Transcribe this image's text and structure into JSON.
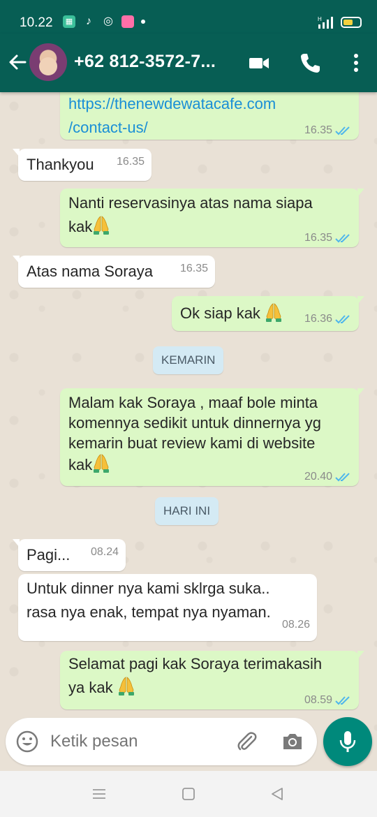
{
  "status_bar": {
    "time": "10.22",
    "colors": {
      "background": "#075e54",
      "battery": "#f4d03f"
    },
    "icons": [
      "calculator-icon",
      "tiktok-icon",
      "instagram-icon",
      "app-icon",
      "notification-dot",
      "signal-icon",
      "battery-icon"
    ],
    "signal_label": "H"
  },
  "header": {
    "contact_name": "+62 812-3572-7...",
    "icons": [
      "back-arrow-icon",
      "video-call-icon",
      "phone-icon",
      "more-vert-icon"
    ],
    "colors": {
      "background": "#075e54"
    }
  },
  "messages": [
    {
      "direction": "outgoing",
      "text_parts": [
        "https://thenewdewatacafe.com",
        "/contact-us/"
      ],
      "time": "16.35",
      "status": "read"
    },
    {
      "direction": "incoming",
      "text": "Thankyou",
      "time": "16.35"
    },
    {
      "direction": "outgoing",
      "text_line1": "Nanti reservasinya atas nama siapa",
      "text_line2": "kak",
      "emoji": "folded-hands",
      "time": "16.35",
      "status": "read"
    },
    {
      "direction": "incoming",
      "text": "Atas nama Soraya",
      "time": "16.35"
    },
    {
      "direction": "outgoing",
      "text": "Ok siap kak",
      "emoji": "folded-hands",
      "time": "16.36",
      "status": "read"
    },
    {
      "type": "date",
      "text": "KEMARIN"
    },
    {
      "direction": "outgoing",
      "text_lines": [
        "Malam kak Soraya , maaf bole minta",
        "komennya sedikit untuk dinnernya yg",
        "kemarin buat review kami di website",
        "kak"
      ],
      "emoji": "folded-hands",
      "time": "20.40",
      "status": "read"
    },
    {
      "type": "date",
      "text": "HARI INI"
    },
    {
      "direction": "incoming",
      "text": "Pagi...",
      "time": "08.24"
    },
    {
      "direction": "incoming",
      "text_lines": [
        "Untuk dinner nya kami sklrga suka..",
        "rasa nya enak, tempat nya nyaman."
      ],
      "time": "08.26"
    },
    {
      "direction": "outgoing",
      "text_lines": [
        "Selamat pagi kak Soraya terimakasih",
        "ya kak"
      ],
      "emoji": "folded-hands",
      "time": "08.59",
      "status": "read"
    }
  ],
  "input": {
    "placeholder": "Ketik pesan",
    "icons": [
      "emoji-icon",
      "attach-icon",
      "camera-icon",
      "mic-icon"
    ]
  },
  "nav_bar": {
    "icons": [
      "recents-icon",
      "home-icon",
      "back-icon"
    ]
  },
  "colors": {
    "outgoing_bubble": "#dcf8c6",
    "incoming_bubble": "#ffffff",
    "chat_background": "#e9e1d6",
    "read_ticks": "#4fb6ec",
    "link": "#1a8fd6",
    "mic_button": "#00897b",
    "date_pill": "#d4eaf4"
  }
}
